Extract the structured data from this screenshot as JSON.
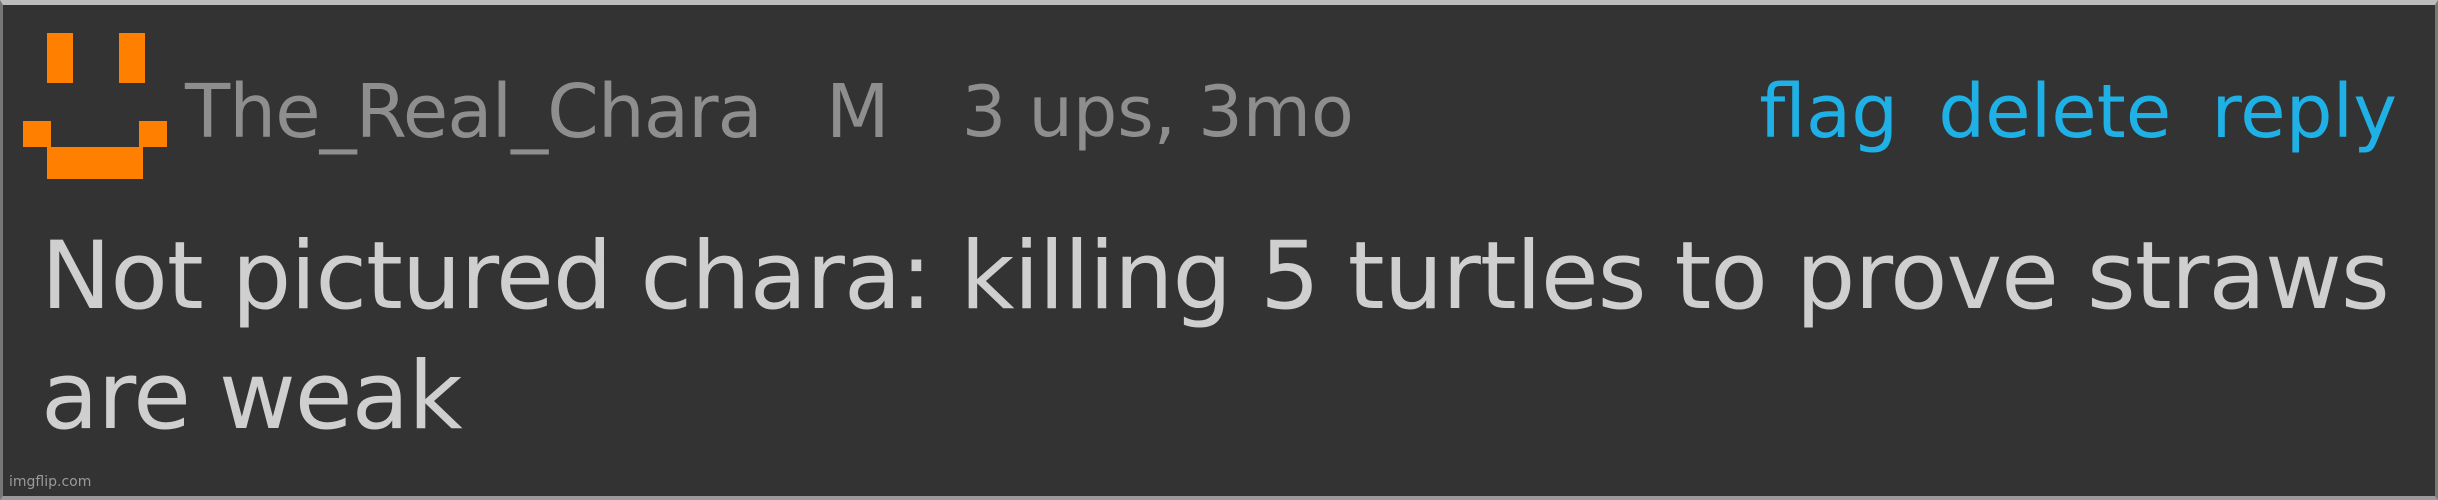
{
  "comment": {
    "username": "The_Real_Chara",
    "gender": "M",
    "meta": "3 ups, 3mo",
    "text": "Not pictured chara: killing 5 turtles to prove straws are weak"
  },
  "actions": {
    "flag": "flag",
    "delete": "delete",
    "reply": "reply"
  },
  "avatar": {
    "icon": "pixel-smiley-icon",
    "color": "#ff7f00"
  },
  "colors": {
    "background": "#333333",
    "username": "#8e8e8e",
    "action": "#1fb0e6",
    "body_text": "#cfcfcf"
  },
  "watermark": "imgflip.com"
}
